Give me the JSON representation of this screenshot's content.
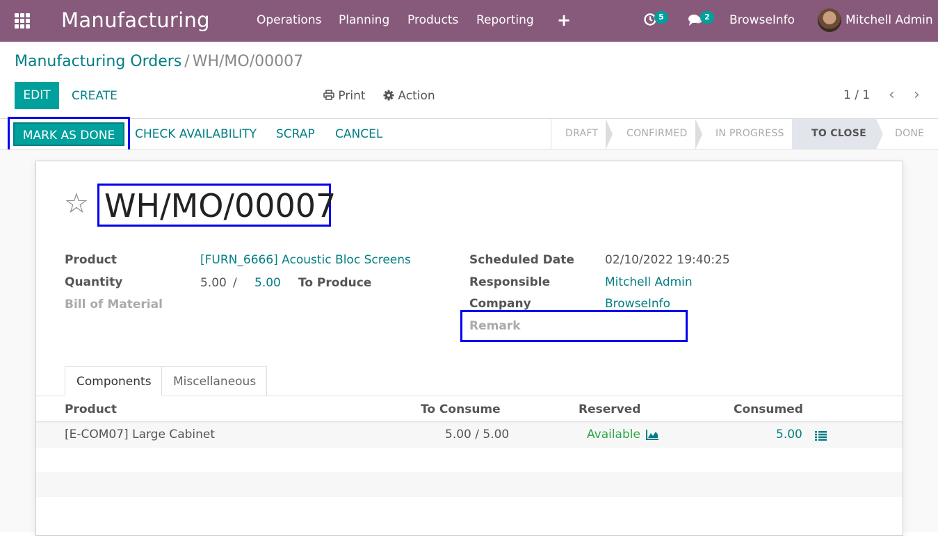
{
  "navbar": {
    "app_title": "Manufacturing",
    "menu": [
      "Operations",
      "Planning",
      "Products",
      "Reporting"
    ],
    "plus_icon": "+",
    "activity_count": "5",
    "message_count": "2",
    "company": "BrowseInfo",
    "user": "Mitchell Admin",
    "color": "#875a7b"
  },
  "control_panel": {
    "breadcrumb_parent": "Manufacturing Orders",
    "breadcrumb_sep": "/",
    "breadcrumb_current": "WH/MO/00007",
    "edit_label": "EDIT",
    "create_label": "CREATE",
    "print_label": "Print",
    "action_label": "Action",
    "pager": "1 / 1"
  },
  "statusbar": {
    "buttons": [
      "MARK AS DONE",
      "CHECK AVAILABILITY",
      "SCRAP",
      "CANCEL"
    ],
    "stages": [
      "DRAFT",
      "CONFIRMED",
      "IN PROGRESS",
      "TO CLOSE",
      "DONE"
    ],
    "active_stage": "TO CLOSE"
  },
  "form": {
    "title": "WH/MO/00007",
    "product_label": "Product",
    "product_value": "[FURN_6666] Acoustic Bloc Screens",
    "quantity_label": "Quantity",
    "quantity_value": "5.00",
    "quantity_sep": "/",
    "quantity_produce": "5.00",
    "to_produce_label": "To Produce",
    "bom_label": "Bill of Material",
    "scheduled_label": "Scheduled Date",
    "scheduled_value": "02/10/2022 19:40:25",
    "responsible_label": "Responsible",
    "responsible_value": "Mitchell Admin",
    "company_label": "Company",
    "company_value": "BrowseInfo",
    "remark_label": "Remark"
  },
  "tabs": [
    "Components",
    "Miscellaneous"
  ],
  "table": {
    "headers": [
      "Product",
      "To Consume",
      "Reserved",
      "Consumed"
    ],
    "rows": [
      {
        "product": "[E-COM07] Large Cabinet",
        "to_consume": "5.00 / 5.00",
        "reserved": "Available",
        "consumed": "5.00"
      }
    ]
  },
  "colors": {
    "primary": "#00a09d",
    "link": "#017e84",
    "highlight_frame": "#0000ee",
    "available": "#28a745"
  }
}
